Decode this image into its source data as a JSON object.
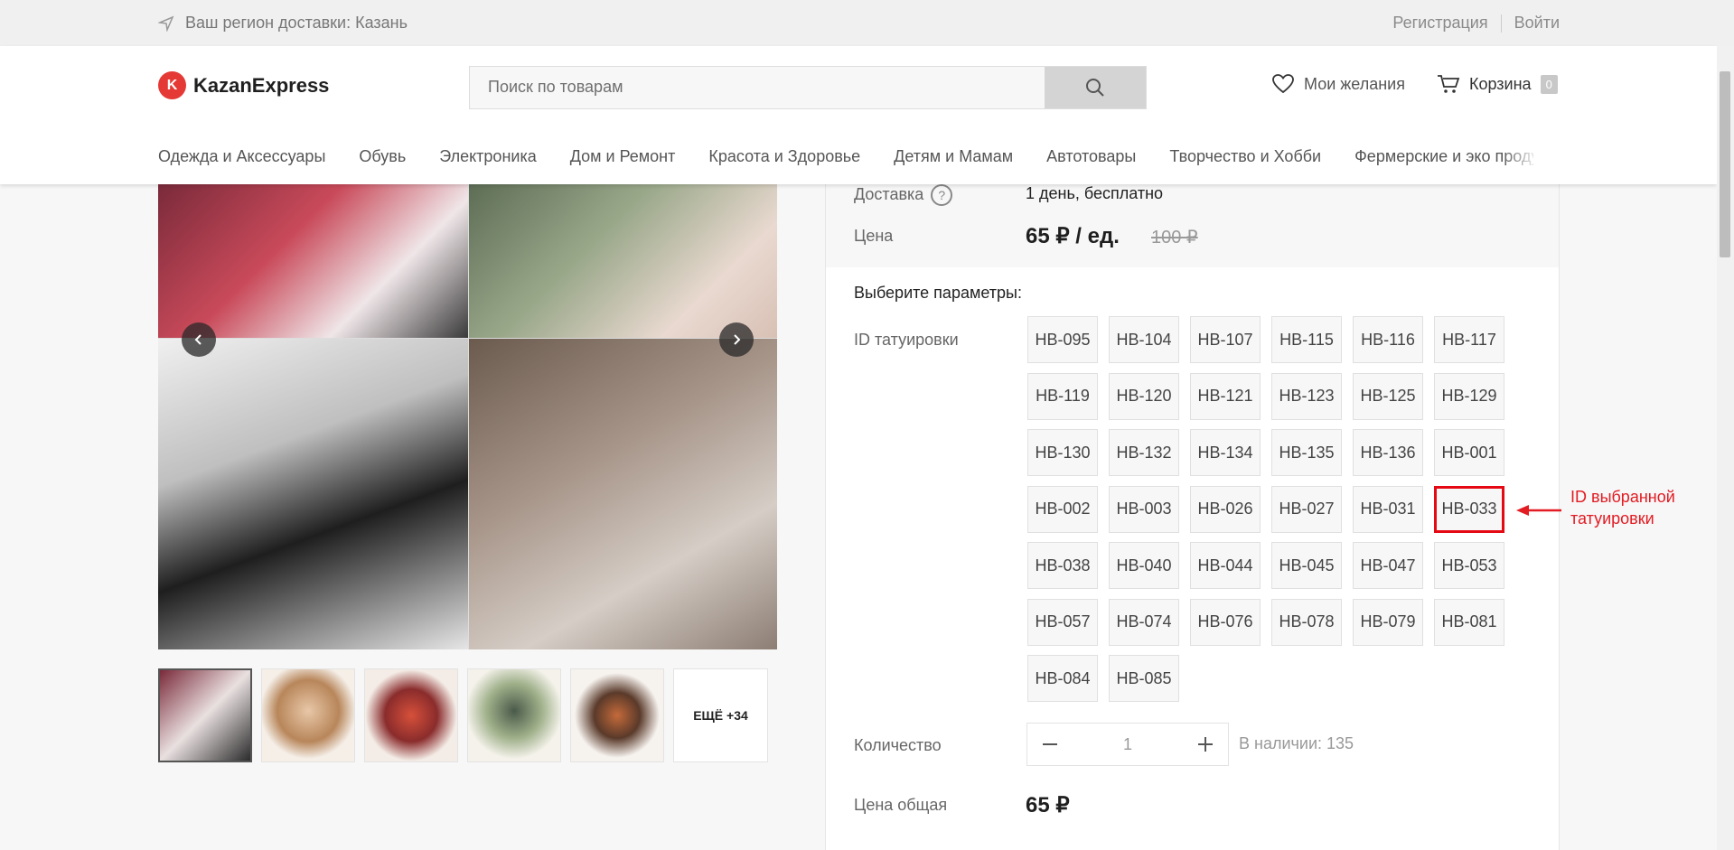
{
  "topbar": {
    "region": "Ваш регион доставки: Казань",
    "register": "Регистрация",
    "login": "Войти"
  },
  "header": {
    "logo": "KazanExpress",
    "search_placeholder": "Поиск по товарам",
    "wishlist": "Мои желания",
    "cart": "Корзина",
    "cart_count": "0",
    "categories": [
      "Одежда и Аксессуары",
      "Обувь",
      "Электроника",
      "Дом и Ремонт",
      "Красота и Здоровье",
      "Детям и Мамам",
      "Автотовары",
      "Творчество и Хобби",
      "Фермерские и эко проду"
    ]
  },
  "gallery": {
    "more_label": "ЕЩЁ +34"
  },
  "product": {
    "delivery_label": "Доставка",
    "delivery_value": "1 день, бесплатно",
    "price_label": "Цена",
    "price": "65 ₽ / ед.",
    "old_price": "100 ₽",
    "params_title": "Выберите параметры:",
    "tattoo_id_label": "ID татуировки",
    "options": [
      "HB-095",
      "HB-104",
      "HB-107",
      "HB-115",
      "HB-116",
      "HB-117",
      "HB-119",
      "HB-120",
      "HB-121",
      "HB-123",
      "HB-125",
      "HB-129",
      "HB-130",
      "HB-132",
      "HB-134",
      "HB-135",
      "HB-136",
      "HB-001",
      "HB-002",
      "HB-003",
      "HB-026",
      "HB-027",
      "HB-031",
      "HB-033",
      "HB-038",
      "HB-040",
      "HB-044",
      "HB-045",
      "HB-047",
      "HB-053",
      "HB-057",
      "HB-074",
      "HB-076",
      "HB-078",
      "HB-079",
      "HB-081",
      "HB-084",
      "HB-085"
    ],
    "selected": "HB-033",
    "qty_label": "Количество",
    "qty": "1",
    "stock": "В наличии: 135",
    "total_label": "Цена общая",
    "total": "65 ₽"
  },
  "annotation": {
    "line1": "ID выбранной",
    "line2": "татуировки",
    "color": "#e31b23"
  }
}
